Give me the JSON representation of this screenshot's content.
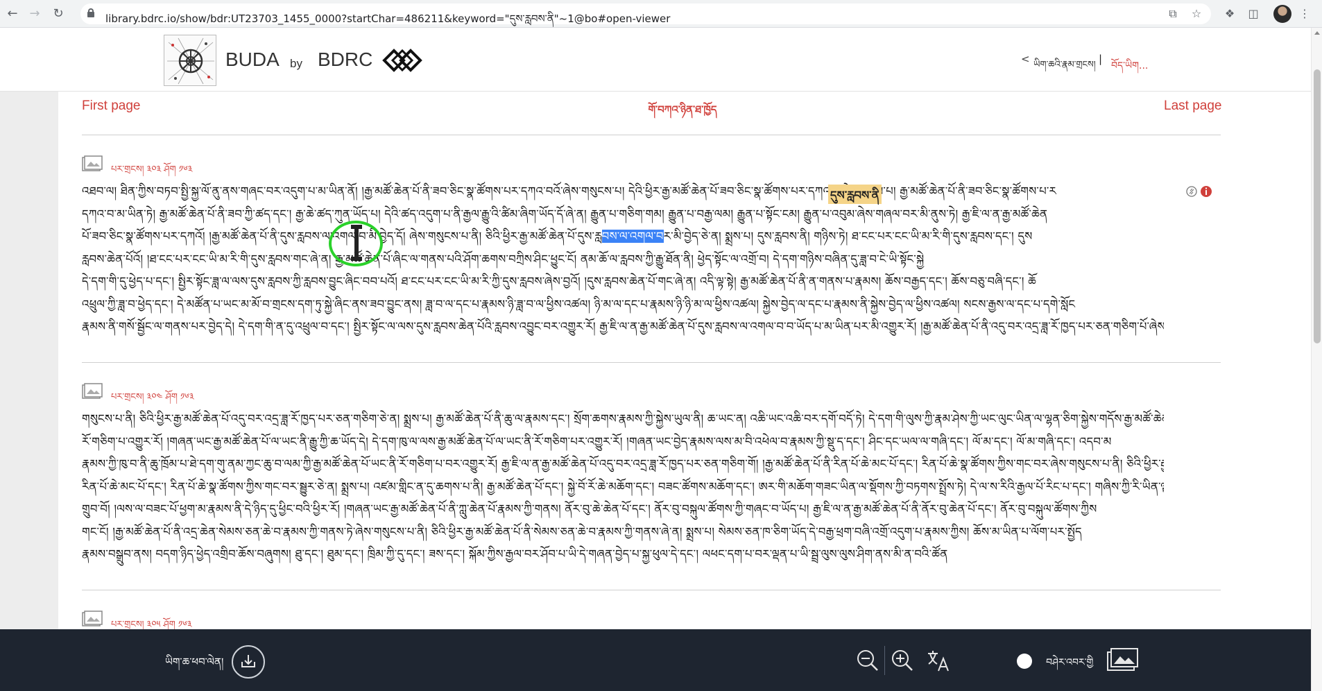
{
  "browser": {
    "url": "library.bdrc.io/show/bdr:UT23703_1455_0000?startChar=486211&keyword=\"དུས་རླབས་ནི\"~1@bo#open-viewer"
  },
  "header": {
    "brand_buda": "BUDA",
    "brand_by": "by",
    "brand_bdrc": "BDRC",
    "back_chevron": "<",
    "right_link": "ཡིག་ཆའི་རྣམ་གྲངས།",
    "separator": "|",
    "lang": "བོད་ཡིག..."
  },
  "viewer": {
    "first_page": "First page",
    "last_page": "Last page",
    "center_link": "གོ་བཀའ་ཉིན་ཐ་ཁྱོད"
  },
  "pages": [
    {
      "label": "པར་གྲངས། ༣༠༣ ཤོག ༡༦༣",
      "lines": [
        {
          "pre": "འཐབ་ལ། ཐིན་ཀྱིས་བཏབ་སྤྱི་སྐྱ་ལོ་ནུ་ནས་གཞང་བར་འདུག་པ་མ་ཡིན་ནོ། །རྒྱ་མཚོ་ཆེན་པོ་ནི་ཟབ་ཅིང་སྣ་ཚོགས་པར་དཀའ་བའོ་ཞེས་གསུངས་པ། དེའི་ཕྱིར་རྒྱ་མཚོ་ཆེན་པོ་ཟབ་ཅིང་སྣ་ཚོགས་པར་དཀའ་བ་ཞེ་ན། སྨྲས་པ། རྒྱ་མཚོ་ཆེན་པོ་ནི་ཟབ་ཅིང་སྣ་ཚོགས་པ་ར",
          "hl": "",
          "post": ""
        },
        {
          "pre": "དཀའ་བ་མ་ཡིན་ཏེ། རྒྱ་མཚོ་ཆེན་པོ་ནི་ཟབ་ཀྱི་ཚད་དང་། རྒྱ་ཆེ་ཚད་ཀུན་ཡོད་པ། དེའི་ཚད་འདུག་པ་ནི་རྒྱལ་རྒྱུ་འི་ཚིམ་ཞིག་ཡོད་དོ་ཞེ་ན། རྒྱུན་པ་གཅིག་གམ། རྒྱུན་པ་བརྒྱ་ལམ། རྒྱུན་པ་སྟོང་ངམ། རྒྱུན་པ་འབུམ་ཞེས་གཞལ་བར་མི་ནུས་ཏེ། རྒྱ་ཇི་ལ་ན་རྒྱ་མཚོ་ཆེན",
          "hl": "",
          "post": ""
        },
        {
          "pre": "པོ་ཟབ་ཅིང་སྣ་ཚོགས་པར་དཀའོ། །རྒྱ་མཚོ་ཆེན་པོ་ནི་དུས་རླབས་ལ་འགལ་བ་མི་བྱེད་དོ། ཞེས་གསུངས་པ་ནི། ཅིའི་ཕྱིར་རྒྱ་མཚོ་ཆེན་པོ་དུས་རླ",
          "hl": "བས་ལ་འགལ་བ",
          "post": "ར་མི་བྱེད་ཅེ་ན། སྨྲས་པ། དུས་རླབས་ནི། གཉིས་ཏེ། ཐ་ངང་པར་ངང་ཡི་མ་རི་གི་དུས་རླབས་དང་། དུས"
        },
        {
          "pre": "རླབས་ཆེན་པོའོ། །ཐ་ངང་པར་ངང་ཡི་མ་རི་གི་དུས་རླབས་གང་ཞེ་ན། རྒྱ་མཚོ་ཆེན་པོ་ཞིང་ལ་གནས་པའི་ཤོག་ཆགས་བཀྲིས་ཤིང་ཕྱུང་ངོ། ནམ་ཆོ་ལ་རླབས་ཀྱི་རྒྱུ་ཐོན་ནི། ཕྱེད་སྟོང་ལ་འགྲོ་བ། དེ་དག་གཉིས་བཞིན་དུ་ཟླ་བ་ངེ་ཡི་སྟོང་སྐྱེ",
          "hl": "",
          "post": ""
        },
        {
          "pre": "དེ་དག་གི་དུ་ཕྱེད་པ་དང་། སྤྱིར་སྟོང་ཟླ་ལ་ལས་དུས་རླབས་ཀྱི་རླབས་བྱུང་ཞིང་བབ་པའོ། ཐ་ངང་པར་ངང་ཡི་མ་རི་ཀྱི་དུས་རླབས་ཞེས་བྱའོ། །དུས་རླབས་ཆེན་པོ་གང་ཞེ་ན། འདི་ལྟ་སྟེ། རྒྱ་མཚོ་ཆེན་པོ་ནི་ན་གནས་པ་རྣམས། ཆོས་བརྒྱད་དང་། ཆོས་བཅུ་བཞི་དང་། ཆོ",
          "hl": "",
          "post": ""
        },
        {
          "pre": "འཕྲུལ་ཀྱི་ཟླ་བ་ཕྱེད་དང་། དེ་མཚོན་པ་ཡང་མ་མོ་བ་གྲངས་དག་ཏུ་སྐྱེ་ཞིང་ནས་ཟབ་བྱུང་ནས། ཟླ་བ་ལ་དང་པ་རྣམས་ཉི་ཟླ་བ་ལ་ཕྱིས་འཚལ། ཉི་མ་ལ་དང་པ་རྣམས་ཉི་ཉི་མ་ལ་ཕྱིས་འཚལ། སྐྱེས་བྱེད་ལ་དང་པ་རྣམས་ནི་སྐྱེས་བྱེད་ལ་ཕྱིས་འཚལ། སངས་རྒྱས་ལ་དང་པ་དགེ་སློང",
          "hl": "",
          "post": ""
        },
        {
          "pre": "རྣམས་ནི་གསོ་སྦྱོང་ལ་གནས་པར་བྱེད་དེ། དེ་དག་གི་ན་དུ་འཕྲུལ་བ་དང་། སྤྱིར་སྟོང་ལ་ལས་དུས་རླབས་ཆེན་པོའི་རླབས་འབྱུང་བར་འགྱུར་རོ། རྒྱ་ཇི་ལ་ན་རྒྱ་མཚོ་ཆེན་པོ་དུས་རླབས་ལ་འགལ་བ་བ་ཡོད་པ་མ་ཡིན་པར་མི་འགྱུར་རོ། །རྒྱ་མཚོ་ཆེན་པོ་ནི་འདུ་བར་འདྲ་ཟླ་རོ་ཁྱད་པར་ཅན་གཅིག་པོ་ཞེས",
          "hl": "",
          "post": ""
        }
      ]
    },
    {
      "label": "པར་གྲངས། ༣༠༤ ཤོག ༡༦༣",
      "lines": [
        {
          "pre": "གསུངས་པ་ནི། ཅིའི་ཕྱིར་རྒྱ་མཚོ་ཆེན་པོ་འདུ་བར་འདྲ་ཟླ་རོ་ཁྱད་པར་ཅན་གཅིག་ཅེ་ན། སྨྲས་པ། རྒྱ་མཚོ་ཆེན་པོ་ནི་ཆུ་ལ་རྣམས་དང་། སྲོག་ཆགས་རྣམས་ཀྱི་སྐྱེས་ཡུལ་ནི། ཆ་ཡང་ན། འཆི་ཡང་འཆི་བར་དགོ་བདོ་ཏེ། དེ་དག་གི་ལུས་ཀྱི་རྣམ་ཤེས་ཀྱི་ཡང་ལུང་ཡིན་ལ་ལྷན་ཅིག་སྐྱེས་གདོས་རྒྱ་མཚོ་ཆེན་པོ་ཡང་ནི",
          "hl": "",
          "post": ""
        },
        {
          "pre": "རོ་གཅིག་པ་འགྱུར་རོ། །གཞན་ཡང་རྒྱ་མཚོ་ཆེན་པོ་ལ་ཡང་ནི་རྒྱུ་ཀྱི་ཆ་ཡོད་དེ། དེ་དག་ཁུ་ལ་ལས་རྒྱ་མཚོ་ཆེན་པོ་ལ་ཡང་ནི་རོ་གཅིག་པར་འགྱུར་རོ། །གཞན་ཡང་བྱེད་རྣམས་ལས་མ་བི་འཕེལ་བ་རྣམས་ཀྱི་སྡུ་ད་དང་། ཤིང་དང་ཡལ་ལ་གཞི་དང་། ལོ་མ་དང་། ལོ་མ་གཞི་དང་། འདབ་མ",
          "hl": "",
          "post": ""
        },
        {
          "pre": "རྣམས་ཀྱི་ཁུ་བ་ནི་ཆུ་ཁྲོམ་པ་ཐེ་དག་གུ་ནམ་ཀྱང་ཆུ་བ་ལམ་ཀྱི་རྒྱ་མཚོ་ཆེན་པོ་ཡང་ནི་རོ་གཅིག་པ་བར་འགྱུར་རོ། རྒྱ་ཇི་ལ་ན་རྒྱ་མཚོ་ཆེན་པོ་འདུ་བར་འདྲ་ཟླ་རོ་ཁྱད་པར་ཅན་གཅིག་གོ། །རྒྱ་མཚོ་ཆེན་པོ་ནི་རིན་པོ་ཆེ་མང་པོ་དང་། རིན་པོ་ཆེ་སྣ་ཚོགས་ཀྱིས་གང་བར་ཞེས་གསུངས་པ་ནི། ཅིའི་ཕྱིར་རྒྱ་མཚོ་ཆེན་པོ",
          "hl": "",
          "post": ""
        },
        {
          "pre": "རིན་པོ་ཆེ་མང་པོ་དང་། རིན་པོ་ཆེ་སྣ་ཚོགས་ཀྱིས་གང་བར་སྦྱུར་ཅེ་ན། སྨྲས་པ། འཛམ་གླིང་ན་དུ་ཆགས་པ་ནི། རྒྱ་མཚོ་ཆེན་པོ་དང་། སྐྱེ་བོ་རོ་ཆེ་མཆོག་དང་། བཟང་ཚོགས་མཆོག་དང་། ཨར་གི་མཆོག་གཟང་ཡིན་ལ་སྡོགས་ཀྱི་བཏགས་སྤྲོས་ཏེ། དེ་ལ་ས་རིའི་རྒྱལ་པོ་རིང་པ་དང་། གཞིས་ཀྱི་རི་ཡིན་ལྟ་བུ་རྣམས",
          "hl": "",
          "post": ""
        },
        {
          "pre": "གྲུབ་བོ། །ལས་ལ་བཟང་པོ་ཕྱག་མ་རྣམས་ནི་དེ་ཉིད་དུ་ཕྱིང་བའི་ཕྱིར་རོ། །གཞན་ཡང་རྒྱ་མཚོ་ཆེན་པོ་ནི་ཀླུ་ཆེན་པོ་རྣམས་ཀྱི་གནས། ནོར་བུ་ཆེ་ཆེན་པོ་དང་། ནོར་བུ་བསྐུལ་ཚོགས་ཀྱི་གཞང་བ་ཡོད་པ། རྒྱ་ཇི་ལ་ན་རྒྱ་མཚོ་ཆེན་པོ་ནི་ནོར་བུ་ཆེན་པོ་དང་། ནོར་བུ་བསྐུལ་ཚོགས་ཀྱིས",
          "hl": "",
          "post": ""
        },
        {
          "pre": "གང་ངོ། །རྒྱ་མཚོ་ཆེན་པོ་ནི་འདྲ་ཆེན་སེམས་ཅན་ཆེ་བ་རྣམས་ཀྱི་གནས་ཏེ་ཞེས་གསུངས་པ་ནི། ཅིའི་ཕྱིར་རྒྱ་མཚོ་ཆེན་པོ་ནི་སེམས་ཅན་ཆེ་བ་རྣམས་ཀྱི་གནས་ཞེ་ན། སྨྲས་པ། སེམས་ཅན་ཁ་ཅིག་ཡོད་དེ་བརྒྱ་ཕྲག་བཞི་འགྲོ་འདུག་པ་རྣམས་ཀྱིས། ཆོས་མ་ཡིན་པ་ལོག་པར་སྤྱོད",
          "hl": "",
          "post": ""
        },
        {
          "pre": "རྣམས་བསྒྲུབ་ནས། བདག་ཉིད་ཕྱེད་འགྲིབ་ཆོས་བཞུགས། ཐུ་དང་། ཐུམ་དང་། ཁྲིམ་ཀྱི་དུ་དང་། ཟས་དང་། སྐོམ་ཀྱིས་རྒྱལ་བར་ཤོབ་པ་ཡི་དེ་གཞན་བྱེད་པ་སྐྱ་ཕུལ་དེ་དང་། ལཕང་དག་པ་བར་ལྡན་པ་ཡི་སྦྲ་ལུས་ལུས་ཤིག་ནས་མི་ན་བའི་ཚོན",
          "hl": "",
          "post": ""
        }
      ]
    },
    {
      "label": "པར་གྲངས། ༣༠༥ ཤོག ༡༦༣"
    }
  ],
  "first_page_highlight": "དུས་རླབས་ནི",
  "bottom_bar": {
    "download_label": "ཡིག་ཆ་ཕབ་ལེན།",
    "view_label": "བཤེར་འབར་གྱི"
  },
  "colors": {
    "accent": "#d0403b",
    "bottom_bar": "#1e2530",
    "selection": "#3b82f6",
    "keyword_highlight": "#f5d488",
    "cursor_ring": "#2bd12b"
  }
}
